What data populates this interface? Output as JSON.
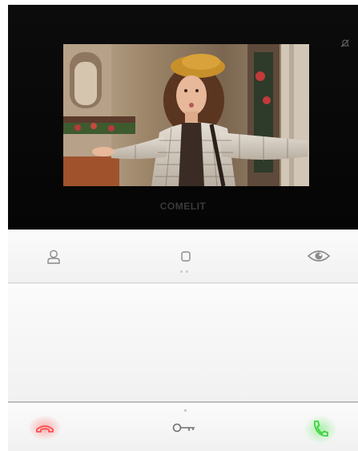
{
  "brand": {
    "name": "COMELIT"
  },
  "screen": {
    "content": "video-feed"
  },
  "top_keys": [
    {
      "icon": "person-icon"
    },
    {
      "icon": "home-square-icon"
    },
    {
      "icon": "eye-icon"
    }
  ],
  "bottom_keys": [
    {
      "icon": "hang-up-icon",
      "color": "#ff4d4d"
    },
    {
      "icon": "key-icon",
      "color": "#6e6e6e"
    },
    {
      "icon": "answer-call-icon",
      "color": "#3cd23c"
    }
  ],
  "colors": {
    "glass": "#0a0a0a",
    "panel": "#f3f3f3",
    "icon_grey": "#8a8a8a",
    "hang_up": "#ff4d4d",
    "answer": "#3cd23c"
  }
}
